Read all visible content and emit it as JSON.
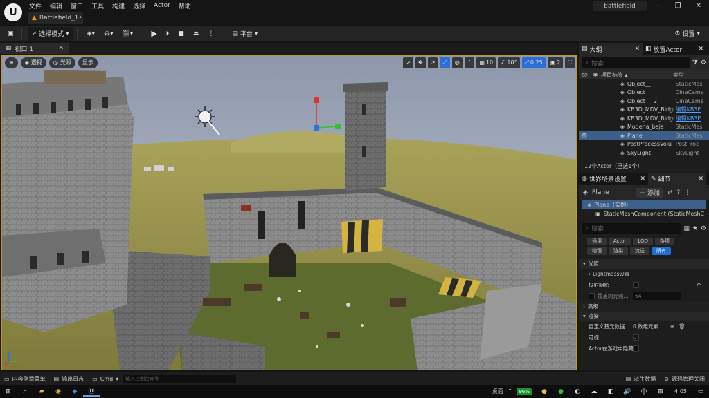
{
  "app": {
    "logo_glyph": "U",
    "menus": [
      "文件",
      "编辑",
      "窗口",
      "工具",
      "构建",
      "选择",
      "Actor",
      "帮助"
    ],
    "doc_tab": "Battlefield_1•",
    "project_name": "battlefield",
    "window_buttons": [
      "—",
      "❐",
      "✕"
    ]
  },
  "toolbar": {
    "save_icon": "💾",
    "mode_label": "选择模式",
    "platform_label": "平台",
    "settings_label": "设置"
  },
  "viewport": {
    "tab_label": "视口 1",
    "menu_icon": "≡",
    "perspective_label": "透视",
    "lighting_label": "光照",
    "show_label": "显示",
    "grid_snap": "10",
    "rot_snap": "10°",
    "scale_snap": "0.25",
    "camera_speed": "2"
  },
  "outliner": {
    "tab_label": "大纲",
    "place_actor_label": "放置Actor",
    "search_placeholder": "搜索",
    "col_label": "项目标签 ▴",
    "col_type": "类型",
    "rows": [
      {
        "name": "Object__",
        "type": "StaticMes",
        "link": false,
        "selected": false
      },
      {
        "name": "Object___",
        "type": "CineCame",
        "link": false,
        "selected": false
      },
      {
        "name": "Object___2",
        "type": "CineCame",
        "link": false,
        "selected": false
      },
      {
        "name": "KB3D_MDV_Bldgl",
        "type": "编辑KB3E",
        "link": true,
        "selected": false
      },
      {
        "name": "KB3D_MDV_Bldgl",
        "type": "编辑KB3E",
        "link": true,
        "selected": false
      },
      {
        "name": "Modena_baja",
        "type": "StaticMes",
        "link": false,
        "selected": false
      },
      {
        "name": "Plane",
        "type": "StaticMes",
        "link": false,
        "selected": true
      },
      {
        "name": "PostProcessVolu",
        "type": "PostProc",
        "link": false,
        "selected": false
      },
      {
        "name": "SkyLight",
        "type": "SkyLight",
        "link": false,
        "selected": false
      }
    ],
    "footer": "12个Actor（已选1个）"
  },
  "details": {
    "tab_world": "世界场景设置",
    "tab_details": "细节",
    "object_name": "Plane",
    "add_label": "添加",
    "instance_label": "Plane（实例）",
    "component_label": "StaticMeshComponent (StaticMeshC",
    "search_placeholder": "搜索",
    "filters": [
      "通用",
      "Actor",
      "LOD",
      "杂项",
      "物理",
      "渲染",
      "流送",
      "所有"
    ],
    "active_filter": "所有",
    "sections": {
      "lighting": "光照",
      "lightmass": "Lightmass设置",
      "cast_shadow": "投射阴影",
      "override_light": "覆盖的光照...",
      "override_value": "64",
      "advanced": "高级",
      "rendering": "渲染",
      "custom_primitive": "自定义基元数据...",
      "custom_value": "0 数组元素",
      "visible": "可视",
      "hidden_in_game": "Actor在游戏中隐藏"
    }
  },
  "statusbar": {
    "content_drawer": "内容侧滑菜单",
    "output_log": "输出日志",
    "cmd": "Cmd",
    "cmd_placeholder": "输入控制台命令",
    "derived_data": "派生数据",
    "source_control": "源码管理关闭"
  },
  "taskbar": {
    "desktop": "桌面",
    "battery": "96%",
    "ime": "中",
    "time": "4:05"
  },
  "colors": {
    "accent_blue": "#1f6fd3",
    "play_green": "#3cb43c",
    "viewport_border": "#c69b00",
    "selection": "#3a5f8a"
  }
}
